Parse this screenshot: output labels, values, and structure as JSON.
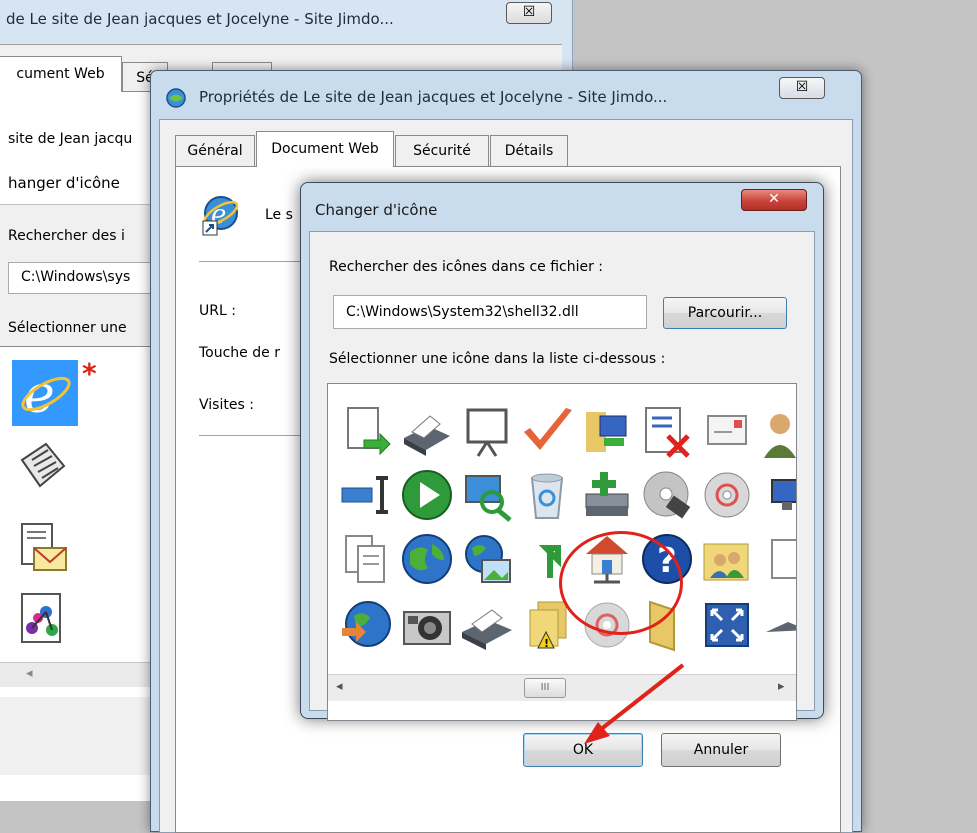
{
  "back_window": {
    "title": "de Le site de Jean jacques et Jocelyne - Site Jimdo...",
    "close_glyph": "☒",
    "tab_label": "cument Web",
    "tab2_label": "Sé",
    "tab3_label": "D",
    "site_text": "site de Jean jacqu",
    "change_icon_label": "hanger d'icône",
    "search_label": "Rechercher des i",
    "path_value": "C:\\Windows\\sys",
    "select_label": "Sélectionner une",
    "scroll_left": "◂",
    "asterisk": "*"
  },
  "prop_window": {
    "title": "Propriétés de Le site de Jean jacques et Jocelyne - Site Jimdo...",
    "close_glyph": "☒",
    "tabs": [
      "Général",
      "Document Web",
      "Sécurité",
      "Détails"
    ],
    "site_prefix": "Le s",
    "url_label": "URL :",
    "hotkey_label": "Touche de r",
    "visits_label": "Visites :"
  },
  "change_icon_dialog": {
    "title": "Changer d'icône",
    "close_glyph": "✕",
    "search_label": "Rechercher des icônes dans ce fichier :",
    "path_value": "C:\\Windows\\System32\\shell32.dll",
    "browse_label": "Parcourir...",
    "select_label": "Sélectionner une icône dans la liste ci-dessous :",
    "scroll_left": "◂",
    "scroll_right": "▸",
    "scroll_thumb": "III",
    "ok_label": "OK",
    "cancel_label": "Annuler"
  },
  "colors": {
    "dialog_title_red": "#c9443b",
    "highlight_red": "#e0221a",
    "selection_blue": "#3399ff"
  }
}
